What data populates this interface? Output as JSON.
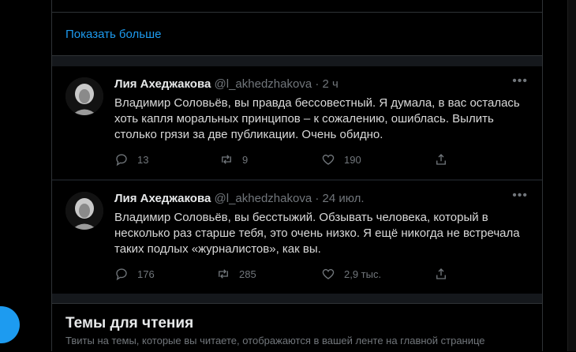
{
  "show_more": {
    "label": "Показать больше"
  },
  "tweets": [
    {
      "author": "Лия Ахеджакова",
      "handle": "@l_akhedzhakova",
      "dot": "·",
      "time": "2 ч",
      "text": "Владимир Соловьёв, вы правда бессовестный. Я думала, в вас осталась хоть капля моральных принципов – к сожалению, ошиблась. Вылить столько грязи за две публикации. Очень обидно.",
      "replies": "13",
      "retweets": "9",
      "likes": "190"
    },
    {
      "author": "Лия Ахеджакова",
      "handle": "@l_akhedzhakova",
      "dot": "·",
      "time": "24 июл.",
      "text": "Владимир Соловьёв, вы бесстыжий. Обзывать человека, который в несколько раз старше тебя, это очень низко. Я ещё никогда не встречала таких подлых «журналистов», как вы.",
      "replies": "176",
      "retweets": "285",
      "likes": "2,9 тыс."
    }
  ],
  "topics": {
    "title": "Темы для чтения",
    "subtitle": "Твиты на темы, которые вы читаете, отображаются в вашей ленте на главной странице"
  },
  "colors": {
    "accent": "#1d9bf0",
    "background": "#000000",
    "muted": "#71767b"
  }
}
